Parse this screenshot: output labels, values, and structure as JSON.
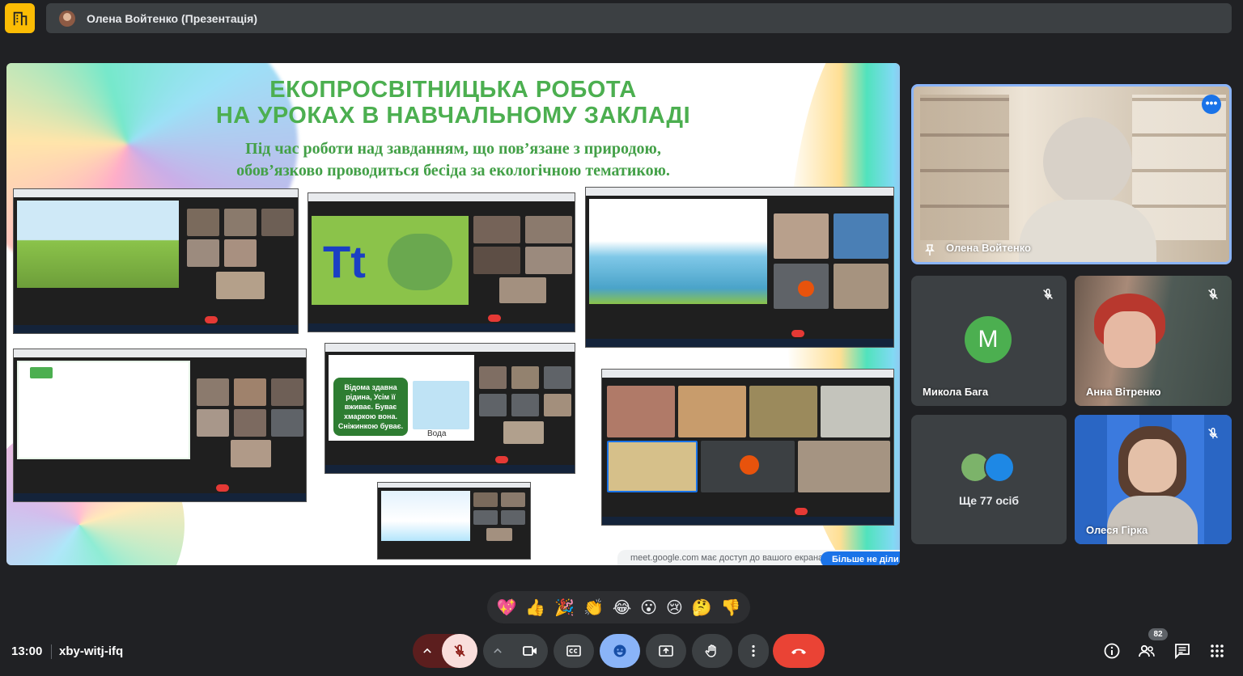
{
  "presenter_bar": {
    "name": "Олена Войтенко (Презентація)"
  },
  "slide": {
    "title_line1": "ЕКОПРОСВІТНИЦЬКА РОБОТА",
    "title_line2": "НА УРОКАХ В НАВЧАЛЬНОМУ ЗАКЛАДІ",
    "subtitle_line1": "Під час роботи над завданням, що пов’язане з природою,",
    "subtitle_line2": "обов’язково проводиться бесіда за екологічною тематикою.",
    "tt_letters": "Tt",
    "voda_card": "Відома здавна рідина, Усім її вживає. Буває хмаркою вона. Сніжинкою буває.",
    "voda_word": "Вода",
    "share_notice": "meet.google.com має доступ до вашого екрана.",
    "share_button": "Більше не діли"
  },
  "participants": [
    {
      "name": "Олена Войтенко",
      "active": true
    },
    {
      "name": "Микола Бага",
      "initial": "M",
      "avatar_color": "#4caf50",
      "muted": true
    },
    {
      "name": "Анна Вітренко",
      "muted": true
    },
    {
      "name": "Олеся Гірка",
      "muted": true
    }
  ],
  "others": {
    "label": "Ще 77 осіб"
  },
  "reactions": [
    "💖",
    "👍",
    "🎉",
    "👏",
    "😂",
    "😮",
    "😢",
    "🤔",
    "👎"
  ],
  "bottom": {
    "time": "13:00",
    "meeting_code": "xby-witj-ifq",
    "people_count": "82"
  },
  "colors": {
    "hangup": "#ea4335",
    "mic_muted_bg": "#f9dedc",
    "reaction_active": "#8ab4f8",
    "active_border": "#8ab4f8"
  }
}
